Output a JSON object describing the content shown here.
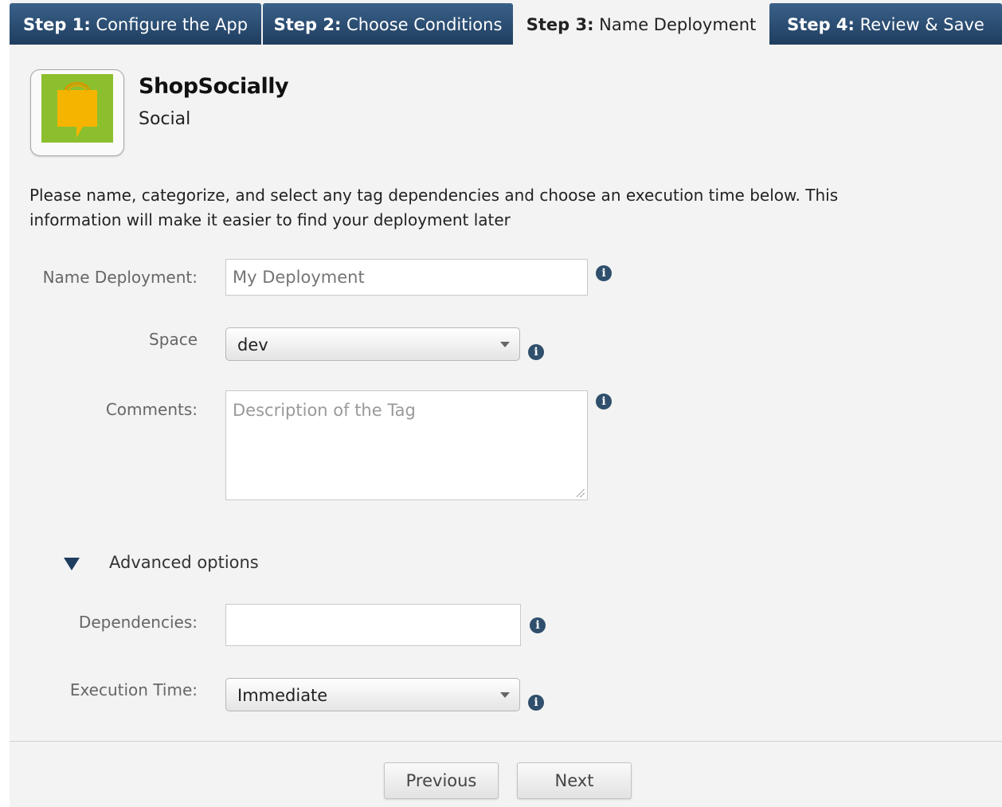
{
  "tabs": [
    {
      "step": "Step 1:",
      "label": "Configure the App"
    },
    {
      "step": "Step 2:",
      "label": "Choose Conditions"
    },
    {
      "step": "Step 3:",
      "label": "Name Deployment"
    },
    {
      "step": "Step 4:",
      "label": "Review & Save"
    }
  ],
  "active_tab": 2,
  "app": {
    "name": "ShopSocially",
    "category": "Social",
    "icon": "shopping-bag-speech-icon",
    "icon_color": "#F5B400",
    "tile_color": "#8CBF2E"
  },
  "intro": "Please name, categorize, and select any tag dependencies and choose an execution time below. This information will make it easier to find your deployment later",
  "form": {
    "name_label": "Name Deployment:",
    "name_placeholder": "My Deployment",
    "space_label": "Space",
    "space_value": "dev",
    "comments_label": "Comments:",
    "comments_placeholder": "Description of the Tag",
    "advanced_label": "Advanced options",
    "dependencies_label": "Dependencies:",
    "dependencies_value": "",
    "execution_label": "Execution Time:",
    "execution_value": "Immediate"
  },
  "info_glyph": "i",
  "buttons": {
    "previous": "Previous",
    "next": "Next"
  },
  "colors": {
    "tab_bg": "#2A4A6E",
    "info_icon": "#2F4F6C"
  }
}
